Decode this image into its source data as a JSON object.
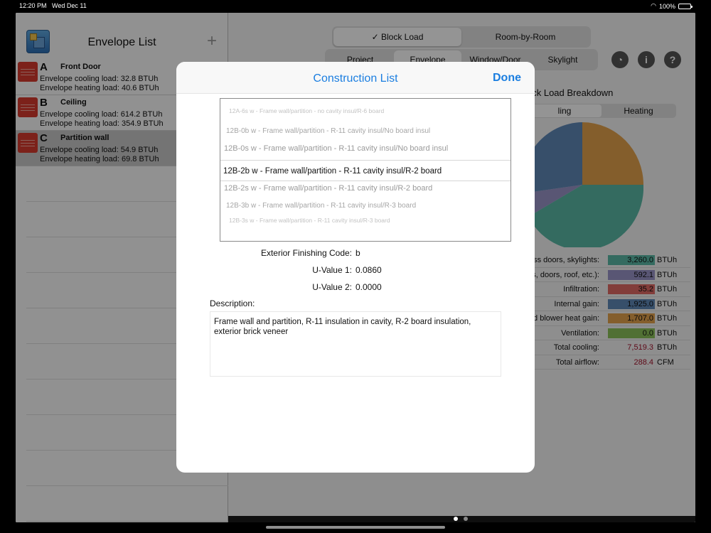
{
  "status_bar": {
    "time": "12:20 PM",
    "date": "Wed Dec 11",
    "battery": "100%"
  },
  "sidebar": {
    "title": "Envelope List",
    "add_label": "+",
    "items": [
      {
        "letter": "A",
        "name": "Front Door",
        "cooling": "Envelope cooling load: 32.8 BTUh",
        "heating": "Envelope heating load: 40.6 BTUh",
        "selected": false
      },
      {
        "letter": "B",
        "name": "Ceiling",
        "cooling": "Envelope cooling load: 614.2 BTUh",
        "heating": "Envelope heating load: 354.9 BTUh",
        "selected": false
      },
      {
        "letter": "C",
        "name": "Partition wall",
        "cooling": "Envelope cooling load: 54.9 BTUh",
        "heating": "Envelope heating load: 69.8 BTUh",
        "selected": true
      }
    ]
  },
  "main": {
    "mode_tabs": [
      "✓ Block Load",
      "Room-by-Room"
    ],
    "section_tabs": [
      "Project",
      "Envelope",
      "Window/Door",
      "Skylight"
    ],
    "breakdown_title": "ock Load Breakdown",
    "cool_heat": [
      "ling",
      "Heating"
    ],
    "loads": [
      {
        "label": "ss doors, skylights:",
        "value": "3,260.0",
        "unit": "BTUh",
        "color": "#5bb8a6"
      },
      {
        "label": "s, doors, roof, etc.):",
        "value": "592.1",
        "unit": "BTUh",
        "color": "#9a95c9"
      },
      {
        "label": "Infiltration:",
        "value": "35.2",
        "unit": "BTUh",
        "color": "#e06a64"
      },
      {
        "label": "Internal gain:",
        "value": "1,925.0",
        "unit": "BTUh",
        "color": "#5f88b7"
      },
      {
        "label": "d blower heat gain:",
        "value": "1,707.0",
        "unit": "BTUh",
        "color": "#e4a34c"
      },
      {
        "label": "Ventilation:",
        "value": "0.0",
        "unit": "BTUh",
        "color": "#8cc25a"
      },
      {
        "label": "Total cooling:",
        "value": "7,519.3",
        "unit": "BTUh",
        "color": ""
      },
      {
        "label": "Total airflow:",
        "value": "288.4",
        "unit": "CFM",
        "color": ""
      }
    ]
  },
  "modal": {
    "title": "Construction List",
    "done_label": "Done",
    "picker_items": [
      "12A-6s w - Frame wall/partition - no cavity insul/R-6 board",
      "12B-0b w - Frame wall/partition - R-11 cavity insul/No board insul",
      "12B-0s w - Frame wall/partition - R-11 cavity insul/No board insul",
      "12B-2b w - Frame wall/partition - R-11 cavity insul/R-2 board",
      "12B-2s w - Frame wall/partition - R-11 cavity insul/R-2 board",
      "12B-3b w - Frame wall/partition - R-11 cavity insul/R-3 board",
      "12B-3s w - Frame wall/partition - R-11 cavity insul/R-3 board"
    ],
    "selected_index": 3,
    "finishing_label": "Exterior Finishing Code:",
    "finishing_value": "b",
    "u1_label": "U-Value 1:",
    "u1_value": "0.0860",
    "u2_label": "U-Value 2:",
    "u2_value": "0.0000",
    "description_label": "Description:",
    "description": "Frame wall and partition, R-11 insulation in cavity, R-2 board insulation, exterior brick veneer"
  }
}
